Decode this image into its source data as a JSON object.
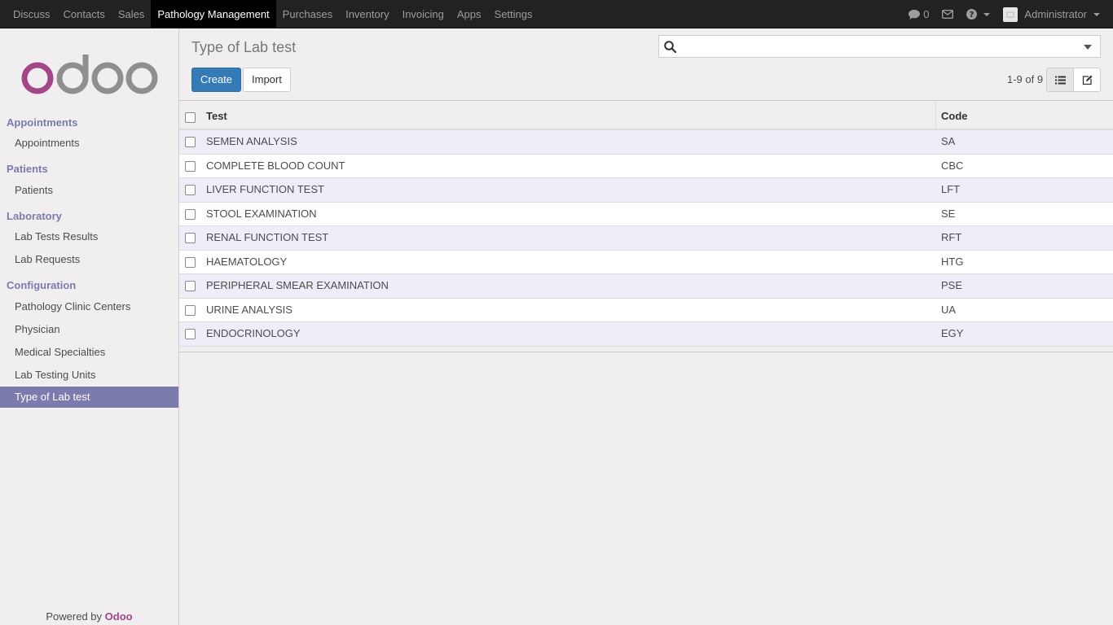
{
  "topbar": {
    "menu": [
      "Discuss",
      "Contacts",
      "Sales",
      "Pathology Management",
      "Purchases",
      "Inventory",
      "Invoicing",
      "Apps",
      "Settings"
    ],
    "active_menu": "Pathology Management",
    "messages_count": "0",
    "user": "Administrator"
  },
  "sidebar": {
    "sections": [
      {
        "title": "Appointments",
        "items": [
          "Appointments"
        ]
      },
      {
        "title": "Patients",
        "items": [
          "Patients"
        ]
      },
      {
        "title": "Laboratory",
        "items": [
          "Lab Tests Results",
          "Lab Requests"
        ]
      },
      {
        "title": "Configuration",
        "items": [
          "Pathology Clinic Centers",
          "Physician",
          "Medical Specialties",
          "Lab Testing Units",
          "Type of Lab test"
        ]
      }
    ],
    "active_item": "Type of Lab test",
    "powered_by": "Powered by",
    "powered_brand": "Odoo"
  },
  "control_panel": {
    "title": "Type of Lab test",
    "search_placeholder": "",
    "create_label": "Create",
    "import_label": "Import",
    "pager": "1-9 of 9"
  },
  "table": {
    "columns": [
      "Test",
      "Code"
    ],
    "rows": [
      {
        "test": "SEMEN ANALYSIS",
        "code": "SA"
      },
      {
        "test": "COMPLETE BLOOD COUNT",
        "code": "CBC"
      },
      {
        "test": "LIVER FUNCTION TEST",
        "code": "LFT"
      },
      {
        "test": "STOOL EXAMINATION",
        "code": "SE"
      },
      {
        "test": "RENAL FUNCTION TEST",
        "code": "RFT"
      },
      {
        "test": "HAEMATOLOGY",
        "code": "HTG"
      },
      {
        "test": "PERIPHERAL SMEAR EXAMINATION",
        "code": "PSE"
      },
      {
        "test": "URINE ANALYSIS",
        "code": "UA"
      },
      {
        "test": "ENDOCRINOLOGY",
        "code": "EGY"
      }
    ]
  },
  "colors": {
    "brand_purple": "#7c7bad",
    "odoo_pink": "#a24689",
    "primary_blue": "#337ab7"
  },
  "icons": {
    "messages": "comment-icon",
    "mail": "envelope-icon",
    "help": "question-circle-icon",
    "search": "search-icon",
    "list_view": "list-icon",
    "form_view": "edit-icon"
  }
}
